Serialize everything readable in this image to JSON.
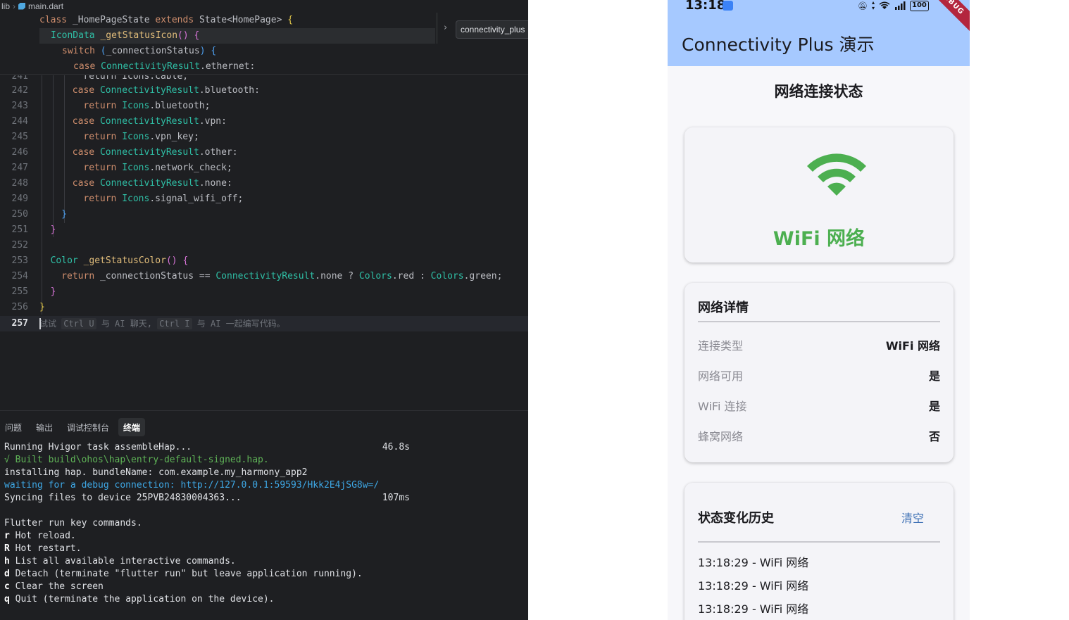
{
  "ide": {
    "breadcrumb": {
      "folder": "lib",
      "file": "main.dart"
    },
    "sticky_tab": "connectivity_plus",
    "sticky_lines": [
      [
        [
          "k",
          "class "
        ],
        [
          "",
          "_HomePageState "
        ],
        [
          "k",
          "extends "
        ],
        [
          "",
          "State"
        ],
        [
          "",
          "<HomePage> "
        ],
        [
          "b1",
          "{"
        ]
      ],
      [
        [
          "cl",
          "IconData "
        ],
        [
          "fn",
          "_getStatusIcon"
        ],
        [
          "b2",
          "() "
        ],
        [
          "b2",
          "{"
        ]
      ],
      [
        [
          "k",
          "switch "
        ],
        [
          "b3",
          "("
        ],
        [
          "",
          "_connectionStatus"
        ],
        [
          "b3",
          ")"
        ],
        [
          "",
          " "
        ],
        [
          "b3",
          "{"
        ]
      ],
      [
        [
          "k",
          "case "
        ],
        [
          "cl",
          "ConnectivityResult"
        ],
        [
          "",
          ".ethernet:"
        ]
      ]
    ],
    "partial_line": {
      "number": "241",
      "text": "return Icons.cable;"
    },
    "code_lines": [
      {
        "n": "242",
        "indent": 3,
        "seg": [
          [
            "k",
            "case "
          ],
          [
            "cl",
            "ConnectivityResult"
          ],
          [
            "",
            ".bluetooth:"
          ]
        ]
      },
      {
        "n": "243",
        "indent": 4,
        "seg": [
          [
            "k",
            "return "
          ],
          [
            "cl",
            "Icons"
          ],
          [
            "",
            ".bluetooth;"
          ]
        ]
      },
      {
        "n": "244",
        "indent": 3,
        "seg": [
          [
            "k",
            "case "
          ],
          [
            "cl",
            "ConnectivityResult"
          ],
          [
            "",
            ".vpn:"
          ]
        ]
      },
      {
        "n": "245",
        "indent": 4,
        "seg": [
          [
            "k",
            "return "
          ],
          [
            "cl",
            "Icons"
          ],
          [
            "",
            ".vpn_key;"
          ]
        ]
      },
      {
        "n": "246",
        "indent": 3,
        "seg": [
          [
            "k",
            "case "
          ],
          [
            "cl",
            "ConnectivityResult"
          ],
          [
            "",
            ".other:"
          ]
        ]
      },
      {
        "n": "247",
        "indent": 4,
        "seg": [
          [
            "k",
            "return "
          ],
          [
            "cl",
            "Icons"
          ],
          [
            "",
            ".network_check;"
          ]
        ]
      },
      {
        "n": "248",
        "indent": 3,
        "seg": [
          [
            "k",
            "case "
          ],
          [
            "cl",
            "ConnectivityResult"
          ],
          [
            "",
            ".none:"
          ]
        ]
      },
      {
        "n": "249",
        "indent": 4,
        "seg": [
          [
            "k",
            "return "
          ],
          [
            "cl",
            "Icons"
          ],
          [
            "",
            ".signal_wifi_off;"
          ]
        ]
      },
      {
        "n": "250",
        "indent": 2,
        "seg": [
          [
            "b3",
            "}"
          ]
        ]
      },
      {
        "n": "251",
        "indent": 1,
        "seg": [
          [
            "b2",
            "}"
          ]
        ]
      },
      {
        "n": "252",
        "indent": 0,
        "seg": []
      },
      {
        "n": "253",
        "indent": 1,
        "seg": [
          [
            "cl",
            "Color "
          ],
          [
            "fn",
            "_getStatusColor"
          ],
          [
            "b2",
            "() "
          ],
          [
            "b2",
            "{"
          ]
        ]
      },
      {
        "n": "254",
        "indent": 2,
        "seg": [
          [
            "k",
            "return "
          ],
          [
            "",
            "_connectionStatus == "
          ],
          [
            "cl",
            "ConnectivityResult"
          ],
          [
            "",
            ".none ? "
          ],
          [
            "cl",
            "Colors"
          ],
          [
            "",
            ".red : "
          ],
          [
            "cl",
            "Colors"
          ],
          [
            "",
            ".green;"
          ]
        ]
      },
      {
        "n": "255",
        "indent": 1,
        "seg": [
          [
            "b2",
            "}"
          ]
        ]
      },
      {
        "n": "256",
        "indent": 0,
        "seg": [
          [
            "b1",
            "}"
          ]
        ]
      }
    ],
    "current_line": "257",
    "hint": {
      "t1": "试试 ",
      "k1": "Ctrl U",
      "t2": " 与 AI 聊天, ",
      "k2": "Ctrl I",
      "t3": " 与 AI 一起编写代码。"
    },
    "panel_tabs": [
      "问题",
      "输出",
      "调试控制台",
      "终端"
    ],
    "active_tab": 3,
    "terminal": [
      {
        "c": "",
        "t": "Running Hvigor task assembleHap...",
        "time": "46.8s"
      },
      {
        "c": "tg",
        "t": "√ Built build\\ohos\\hap\\entry-default-signed.hap."
      },
      {
        "c": "",
        "t": "installing hap. bundleName: com.example.my_harmony_app2"
      },
      {
        "c": "tb",
        "t": "waiting for a debug connection: http://127.0.0.1:59593/Hkk2E4jSG8w=/"
      },
      {
        "c": "",
        "t": "Syncing files to device 25PVB24830004363...",
        "time": "107ms"
      },
      {
        "c": "",
        "t": ""
      },
      {
        "c": "",
        "t": "Flutter run key commands."
      },
      {
        "c": "key",
        "k": "r",
        "t": " Hot reload."
      },
      {
        "c": "key",
        "k": "R",
        "t": " Hot restart."
      },
      {
        "c": "key",
        "k": "h",
        "t": " List all available interactive commands."
      },
      {
        "c": "key",
        "k": "d",
        "t": " Detach (terminate \"flutter run\" but leave application running)."
      },
      {
        "c": "key",
        "k": "c",
        "t": " Clear the screen"
      },
      {
        "c": "key",
        "k": "q",
        "t": " Quit (terminate the application on the device)."
      }
    ]
  },
  "phone": {
    "status_time": "13:18",
    "battery": "100",
    "debug_banner": "DEBUG",
    "app_title": "Connectivity Plus 演示",
    "section_title": "网络连接状态",
    "status_icon": "wifi-icon",
    "status_color": "#4caf50",
    "status_label": "WiFi 网络",
    "details": {
      "title": "网络详情",
      "rows": [
        {
          "label": "连接类型",
          "value": "WiFi 网络"
        },
        {
          "label": "网络可用",
          "value": "是"
        },
        {
          "label": "WiFi 连接",
          "value": "是"
        },
        {
          "label": "蜂窝网络",
          "value": "否"
        }
      ]
    },
    "history": {
      "title": "状态变化历史",
      "clear_label": "清空",
      "items": [
        "13:18:29 - WiFi 网络",
        "13:18:29 - WiFi 网络",
        "13:18:29 - WiFi 网络"
      ]
    }
  }
}
